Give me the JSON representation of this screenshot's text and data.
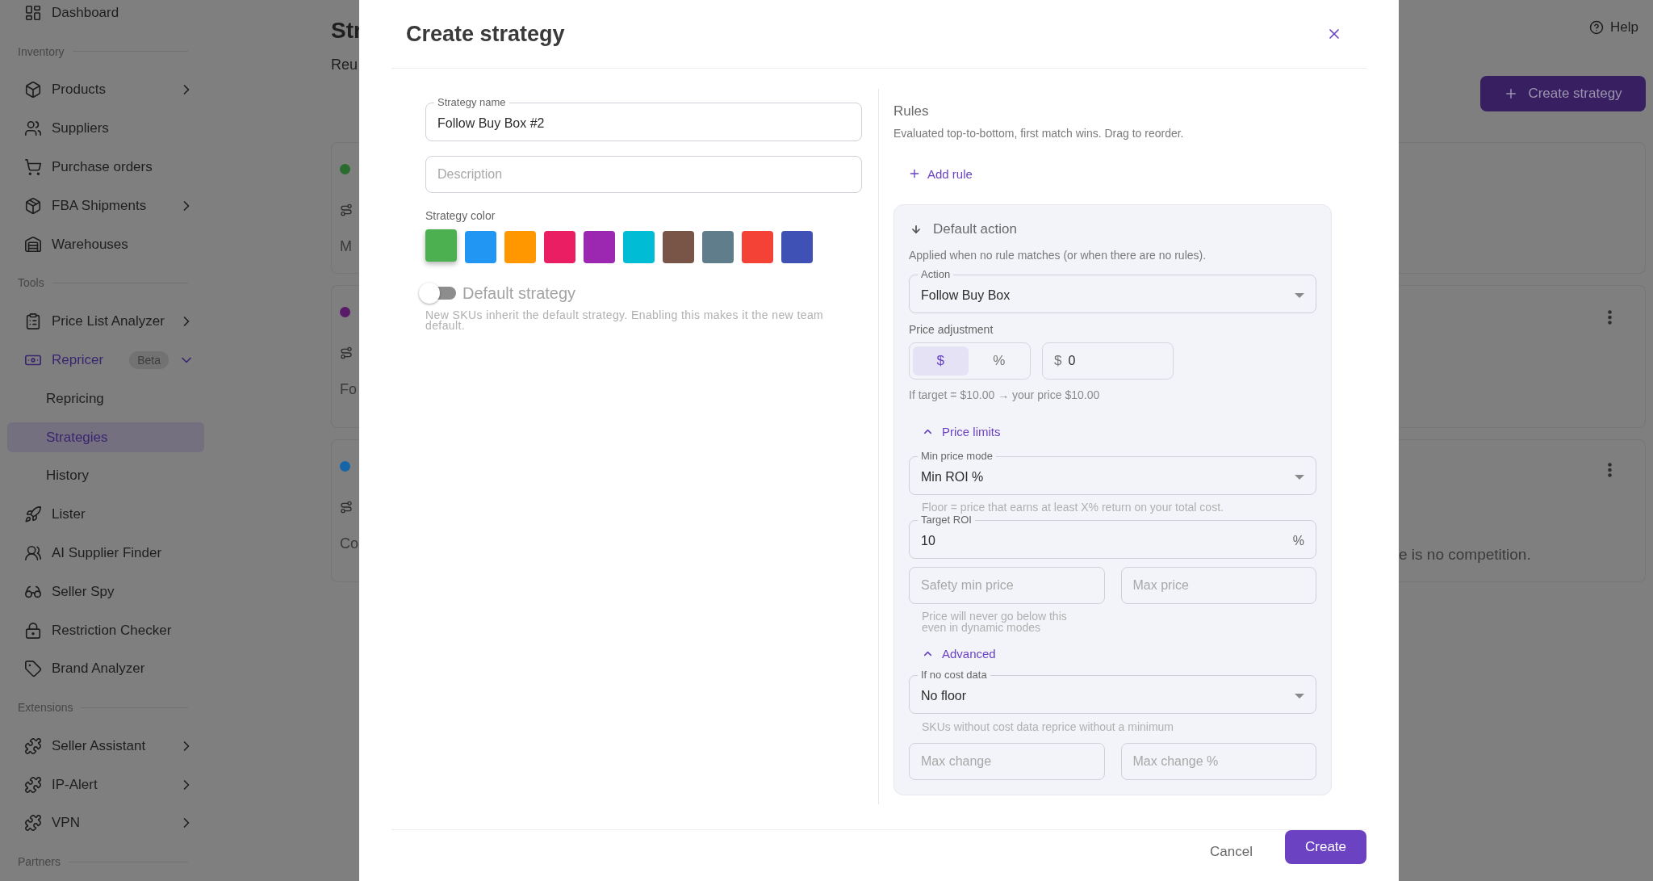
{
  "sidebar": {
    "items": [
      {
        "kind": "link",
        "label": "Dashboard",
        "selected": false
      },
      {
        "kind": "section",
        "label": "Inventory"
      },
      {
        "kind": "group",
        "label": "Products",
        "selected": false,
        "expanded": false
      },
      {
        "kind": "link",
        "label": "Suppliers",
        "selected": false
      },
      {
        "kind": "link",
        "label": "Purchase orders",
        "selected": false
      },
      {
        "kind": "group",
        "label": "FBA Shipments",
        "selected": false,
        "expanded": false
      },
      {
        "kind": "link",
        "label": "Warehouses",
        "selected": false
      },
      {
        "kind": "section",
        "label": "Tools"
      },
      {
        "kind": "group",
        "label": "Price List Analyzer",
        "selected": false,
        "expanded": false
      },
      {
        "kind": "group",
        "label": "Repricer",
        "selected": true,
        "expanded": true,
        "badge": "Beta"
      },
      {
        "kind": "subitem",
        "label": "Repricing",
        "selected": false
      },
      {
        "kind": "subitem",
        "label": "Strategies",
        "selected": true
      },
      {
        "kind": "subitem",
        "label": "History",
        "selected": false
      },
      {
        "kind": "link",
        "label": "Lister",
        "selected": false
      },
      {
        "kind": "link",
        "label": "AI Supplier Finder",
        "selected": false
      },
      {
        "kind": "link",
        "label": "Seller Spy",
        "selected": false
      },
      {
        "kind": "link",
        "label": "Restriction Checker",
        "selected": false
      },
      {
        "kind": "link",
        "label": "Brand Analyzer",
        "selected": false
      },
      {
        "kind": "section",
        "label": "Extensions"
      },
      {
        "kind": "group",
        "label": "Seller Assistant",
        "selected": false,
        "expanded": false
      },
      {
        "kind": "group",
        "label": "IP-Alert",
        "selected": false,
        "expanded": false
      },
      {
        "kind": "group",
        "label": "VPN",
        "selected": false,
        "expanded": false
      },
      {
        "kind": "section",
        "label": "Partners"
      }
    ]
  },
  "page": {
    "title": "Str",
    "subtitle": "Reu",
    "help": "Help",
    "create_button": "Create strategy",
    "cards": [
      {
        "color": "#2a6b2e",
        "text": "M",
        "has_menu": false
      },
      {
        "color": "#5a1a6a",
        "text": "Fo",
        "has_menu": true
      },
      {
        "color": "#1565a8",
        "text": "Co",
        "has_menu": true,
        "text_end": "e is no competition."
      }
    ]
  },
  "dialog": {
    "title": "Create strategy",
    "name_field": {
      "label": "Strategy name",
      "value": "Follow Buy Box #2"
    },
    "description_field": {
      "placeholder": "Description"
    },
    "color_label": "Strategy color",
    "colors": [
      {
        "color": "#4caf50",
        "selected": true
      },
      {
        "color": "#2196f3",
        "selected": false
      },
      {
        "color": "#ff9800",
        "selected": false
      },
      {
        "color": "#e91e63",
        "selected": false
      },
      {
        "color": "#9c27b0",
        "selected": false
      },
      {
        "color": "#00bcd4",
        "selected": false
      },
      {
        "color": "#795548",
        "selected": false
      },
      {
        "color": "#607d8b",
        "selected": false
      },
      {
        "color": "#f44336",
        "selected": false
      },
      {
        "color": "#3f51b5",
        "selected": false
      }
    ],
    "default_toggle": {
      "label": "Default strategy",
      "on": false,
      "hint": "New SKUs inherit the default strategy. Enabling this makes it the new team default."
    },
    "rules": {
      "title": "Rules",
      "hint": "Evaluated top-to-bottom, first match wins. Drag to reorder.",
      "add_rule": "Add rule",
      "default_action": {
        "title": "Default action",
        "hint": "Applied when no rule matches (or when there are no rules).",
        "action": {
          "label": "Action",
          "value": "Follow Buy Box"
        },
        "adjustment": {
          "label": "Price adjustment",
          "units": [
            {
              "label": "$",
              "selected": true
            },
            {
              "label": "%",
              "selected": false
            }
          ],
          "prefix": "$",
          "value": "0",
          "hint": "If target = $10.00 → your price $10.00"
        },
        "price_limits": {
          "label": "Price limits",
          "expanded": true,
          "min_mode": {
            "label": "Min price mode",
            "value": "Min ROI %"
          },
          "min_hint": "Floor = price that earns at least X% return on your total cost.",
          "target_roi": {
            "label": "Target ROI",
            "value": "10",
            "suffix": "%"
          },
          "safety_min": {
            "placeholder": "Safety min price"
          },
          "max_price": {
            "placeholder": "Max price"
          },
          "safety_hint": "Price will never go below this even in dynamic modes"
        },
        "advanced": {
          "label": "Advanced",
          "expanded": true,
          "no_cost": {
            "label": "If no cost data",
            "value": "No floor"
          },
          "hint": "SKUs without cost data reprice without a minimum",
          "max_change": {
            "placeholder": "Max change"
          },
          "max_change_pct": {
            "placeholder": "Max change %"
          }
        }
      }
    },
    "cancel": "Cancel",
    "submit": "Create"
  }
}
